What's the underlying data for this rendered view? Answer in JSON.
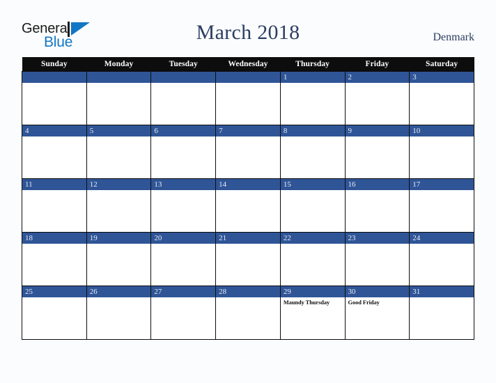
{
  "brand": {
    "name_part1": "General",
    "name_part2": "Blue",
    "mark": "triangle-logo-icon"
  },
  "header": {
    "title": "March 2018",
    "country": "Denmark"
  },
  "calendar": {
    "month": "March",
    "year": "2018",
    "weekday_headers": [
      "Sunday",
      "Monday",
      "Tuesday",
      "Wednesday",
      "Thursday",
      "Friday",
      "Saturday"
    ],
    "weeks": [
      [
        {
          "day": "",
          "events": []
        },
        {
          "day": "",
          "events": []
        },
        {
          "day": "",
          "events": []
        },
        {
          "day": "",
          "events": []
        },
        {
          "day": "1",
          "events": []
        },
        {
          "day": "2",
          "events": []
        },
        {
          "day": "3",
          "events": []
        }
      ],
      [
        {
          "day": "4",
          "events": []
        },
        {
          "day": "5",
          "events": []
        },
        {
          "day": "6",
          "events": []
        },
        {
          "day": "7",
          "events": []
        },
        {
          "day": "8",
          "events": []
        },
        {
          "day": "9",
          "events": []
        },
        {
          "day": "10",
          "events": []
        }
      ],
      [
        {
          "day": "11",
          "events": []
        },
        {
          "day": "12",
          "events": []
        },
        {
          "day": "13",
          "events": []
        },
        {
          "day": "14",
          "events": []
        },
        {
          "day": "15",
          "events": []
        },
        {
          "day": "16",
          "events": []
        },
        {
          "day": "17",
          "events": []
        }
      ],
      [
        {
          "day": "18",
          "events": []
        },
        {
          "day": "19",
          "events": []
        },
        {
          "day": "20",
          "events": []
        },
        {
          "day": "21",
          "events": []
        },
        {
          "day": "22",
          "events": []
        },
        {
          "day": "23",
          "events": []
        },
        {
          "day": "24",
          "events": []
        }
      ],
      [
        {
          "day": "25",
          "events": []
        },
        {
          "day": "26",
          "events": []
        },
        {
          "day": "27",
          "events": []
        },
        {
          "day": "28",
          "events": []
        },
        {
          "day": "29",
          "events": [
            "Maundy Thursday"
          ]
        },
        {
          "day": "30",
          "events": [
            "Good Friday"
          ]
        },
        {
          "day": "31",
          "events": []
        }
      ]
    ]
  },
  "colors": {
    "page_background": "#fbfcfd",
    "header_row": "#0d0d0d",
    "day_bar": "#2f5597",
    "title_text": "#2c3e63",
    "brand_blue": "#1277c4",
    "cell_background": "#ffffff"
  }
}
